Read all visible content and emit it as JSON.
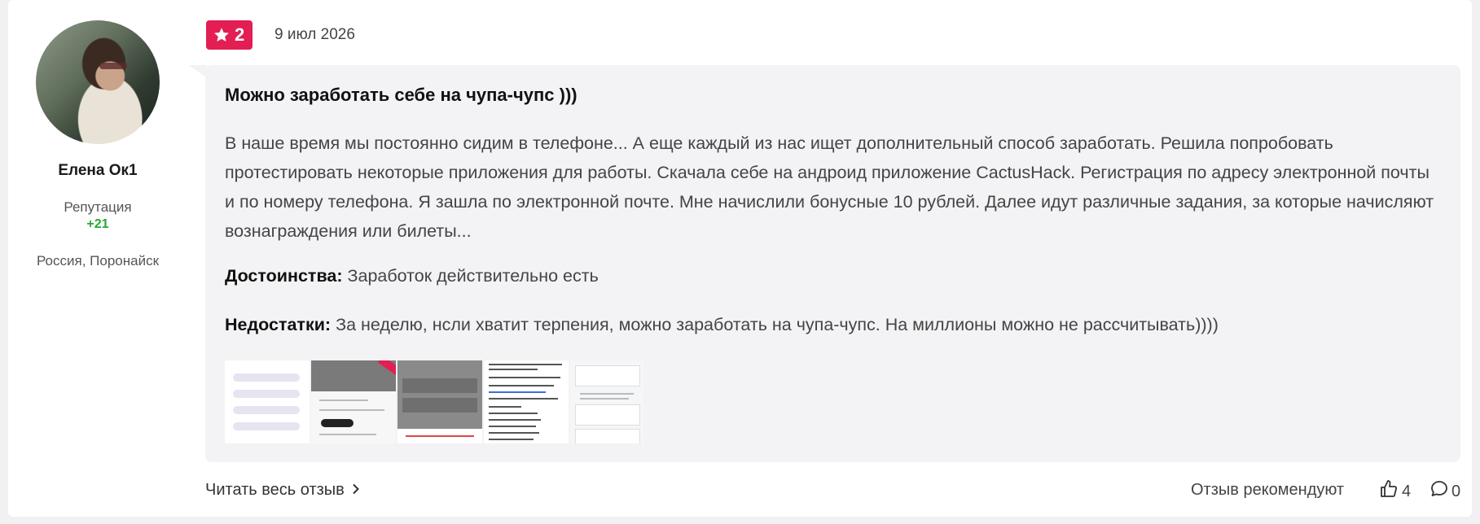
{
  "author": {
    "name": "Елена Ок1",
    "reputation_label": "Репутация",
    "reputation_value": "+21",
    "location": "Россия, Поронайск"
  },
  "review": {
    "rating": "2",
    "date": "9 июл 2026",
    "title": "Можно заработать себе на чупа-чупс )))",
    "body": "В наше время мы постоянно сидим в телефоне... А еще каждый из нас ищет дополнительный способ заработать. Решила попробовать протестировать некоторые приложения для работы. Скачала себе на андроид приложение CactusHack. Регистрация по адресу электронной почты и по номеру телефона. Я зашла по электронной почте. Мне начислили бонусные 10 рублей. Далее идут различные задания, за которые начисляют вознаграждения или билеты...",
    "pros_label": "Достоинства:",
    "pros_text": "Заработок действительно есть",
    "cons_label": "Недостатки:",
    "cons_text": "За неделю, нсли хватит терпения, можно заработать на чупа-чупс. На миллионы можно не рассчитывать))))"
  },
  "footer": {
    "read_more": "Читать весь отзыв",
    "recommend_label": "Отзыв рекомендуют",
    "likes_count": "4",
    "comments_count": "0"
  },
  "colors": {
    "badge": "#e21e52",
    "reputation": "#2aa632",
    "bubble": "#f3f3f5"
  },
  "icons": {
    "star": "star-icon",
    "chevron": "chevron-right-icon",
    "like": "thumbs-up-icon",
    "comment": "comment-icon"
  }
}
